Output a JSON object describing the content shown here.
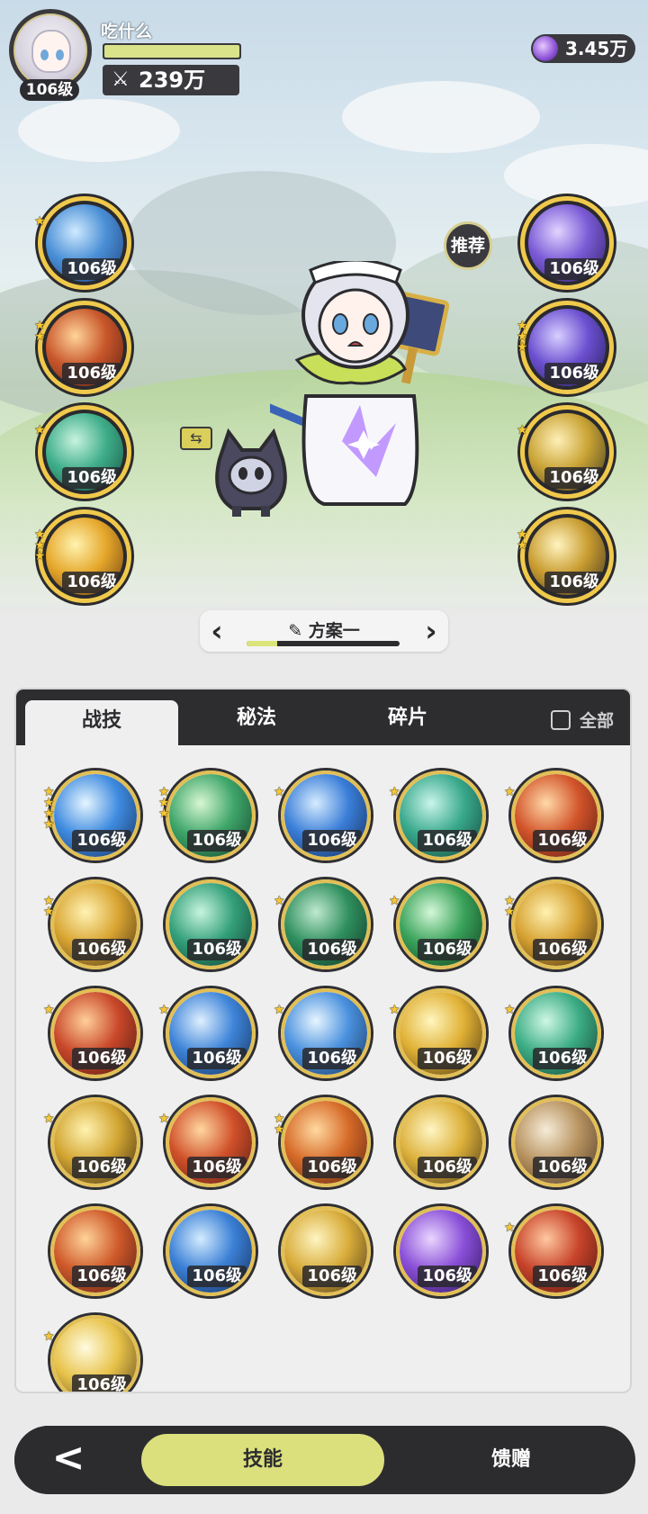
{
  "header": {
    "player_name": "吃什么",
    "level": "106级",
    "exp_progress": 1.0,
    "power": "239万",
    "currency": "3.45万"
  },
  "recommend_label": "推荐",
  "left_slots": [
    {
      "level": "106级",
      "stars": 1,
      "icon": "water-wave-icon",
      "colors": [
        "#cfeaff",
        "#4a8fd6",
        "#1e3f7a"
      ]
    },
    {
      "level": "106级",
      "stars": 2,
      "icon": "fire-meteor-icon",
      "colors": [
        "#ffd49a",
        "#c8562a",
        "#5a1d12"
      ]
    },
    {
      "level": "106级",
      "stars": 1,
      "icon": "wind-vortex-icon",
      "colors": [
        "#c8f3e0",
        "#3fae8a",
        "#14503f"
      ]
    },
    {
      "level": "106级",
      "stars": 3,
      "icon": "lightning-burst-icon",
      "colors": [
        "#fff3b0",
        "#e5a72a",
        "#6a3b10"
      ]
    }
  ],
  "right_slots": [
    {
      "level": "106级",
      "stars": 0,
      "icon": "arcane-stars-icon",
      "colors": [
        "#e1d4ff",
        "#7a5ad6",
        "#2a1d5c"
      ]
    },
    {
      "level": "106级",
      "stars": 3,
      "icon": "arcane-clock-icon",
      "colors": [
        "#d7cfff",
        "#6b4fd0",
        "#231c52"
      ]
    },
    {
      "level": "106级",
      "stars": 1,
      "icon": "golden-arrows-icon",
      "colors": [
        "#fff0b8",
        "#c9a334",
        "#3a3420"
      ]
    },
    {
      "level": "106级",
      "stars": 2,
      "icon": "golden-flash-icon",
      "colors": [
        "#fff4c0",
        "#c99c30",
        "#3a3120"
      ]
    }
  ],
  "plan": {
    "name": "方案一",
    "progress": 0.2
  },
  "tabs": [
    "战技",
    "秘法",
    "碎片"
  ],
  "active_tab": 0,
  "show_all_label": "全部",
  "skills": [
    {
      "level": "106级",
      "stars": 4,
      "icon": "ice-splash-icon",
      "colors": [
        "#e6f6ff",
        "#3f8be0",
        "#15305e"
      ]
    },
    {
      "level": "106级",
      "stars": 3,
      "icon": "green-comet-icon",
      "colors": [
        "#d8f7d3",
        "#3fa66a",
        "#12402a"
      ]
    },
    {
      "level": "106级",
      "stars": 1,
      "icon": "blue-comet-icon",
      "colors": [
        "#d6ecff",
        "#3a7ed8",
        "#132a55"
      ]
    },
    {
      "level": "106级",
      "stars": 1,
      "icon": "teal-spiral-icon",
      "colors": [
        "#c9f5ea",
        "#39a98c",
        "#124338"
      ]
    },
    {
      "level": "106级",
      "stars": 1,
      "icon": "flame-icon",
      "colors": [
        "#ffd9a8",
        "#d2542a",
        "#5a1a12"
      ]
    },
    {
      "level": "106级",
      "stars": 2,
      "icon": "golden-claw-icon",
      "colors": [
        "#fff3b4",
        "#d9a532",
        "#4a3212"
      ]
    },
    {
      "level": "106级",
      "stars": 0,
      "icon": "green-slash-icon",
      "colors": [
        "#c8f4df",
        "#33a07a",
        "#103b2c"
      ]
    },
    {
      "level": "106级",
      "stars": 1,
      "icon": "thorn-vine-icon",
      "colors": [
        "#bfe9cf",
        "#2f8f5e",
        "#0f3322"
      ]
    },
    {
      "level": "106级",
      "stars": 1,
      "icon": "green-plus-icon",
      "colors": [
        "#d4f8d8",
        "#39a25a",
        "#103a1d"
      ]
    },
    {
      "level": "106级",
      "stars": 2,
      "icon": "golden-sparks-icon",
      "colors": [
        "#fff1b0",
        "#d5a030",
        "#3f2c12"
      ]
    },
    {
      "level": "106级",
      "stars": 1,
      "icon": "fire-swirl-icon",
      "colors": [
        "#ffcf9a",
        "#c9482a",
        "#4e1710"
      ]
    },
    {
      "level": "106级",
      "stars": 1,
      "icon": "ice-crystal-icon",
      "colors": [
        "#dff0ff",
        "#3e84d8",
        "#14305a"
      ]
    },
    {
      "level": "106级",
      "stars": 1,
      "icon": "ice-spikes-icon",
      "colors": [
        "#e8f6ff",
        "#4a91de",
        "#173560"
      ]
    },
    {
      "level": "106级",
      "stars": 1,
      "icon": "golden-sun-icon",
      "colors": [
        "#fff6bf",
        "#e0b034",
        "#4b3512"
      ]
    },
    {
      "level": "106级",
      "stars": 1,
      "icon": "wind-orb-icon",
      "colors": [
        "#cff7e6",
        "#3cad85",
        "#123f30"
      ]
    },
    {
      "level": "106级",
      "stars": 1,
      "icon": "golden-triangle-icon",
      "colors": [
        "#fff3b0",
        "#d2a431",
        "#3c2c12"
      ]
    },
    {
      "level": "106级",
      "stars": 1,
      "icon": "fire-orb-icon",
      "colors": [
        "#ffd6a0",
        "#d0502a",
        "#561a12"
      ]
    },
    {
      "level": "106级",
      "stars": 2,
      "icon": "fire-burst-icon",
      "colors": [
        "#ffd9a0",
        "#d66a28",
        "#5a2210"
      ]
    },
    {
      "level": "106级",
      "stars": 0,
      "icon": "golden-explosion-icon",
      "colors": [
        "#fff6c4",
        "#dcb03a",
        "#4a3616"
      ]
    },
    {
      "level": "106级",
      "stars": 0,
      "icon": "card-trick-icon",
      "colors": [
        "#f6ecd8",
        "#b89360",
        "#4a3626"
      ]
    },
    {
      "level": "106级",
      "stars": 0,
      "icon": "fire-wave-icon",
      "colors": [
        "#ffd39a",
        "#cf5a2a",
        "#531a12"
      ]
    },
    {
      "level": "106级",
      "stars": 0,
      "icon": "blue-whirlpool-icon",
      "colors": [
        "#d4ecff",
        "#3b80d6",
        "#132b58"
      ]
    },
    {
      "level": "106级",
      "stars": 0,
      "icon": "golden-star-icon",
      "colors": [
        "#fff5c2",
        "#d8ac3a",
        "#4a3516"
      ]
    },
    {
      "level": "106级",
      "stars": 0,
      "icon": "purple-vortex-icon",
      "colors": [
        "#ead6ff",
        "#8a4fd8",
        "#2b1458"
      ]
    },
    {
      "level": "106级",
      "stars": 1,
      "icon": "red-shatter-icon",
      "colors": [
        "#ffc8a0",
        "#c8442a",
        "#4e1410"
      ]
    },
    {
      "level": "106级",
      "stars": 1,
      "icon": "golden-light-icon",
      "colors": [
        "#fffbe0",
        "#e8c34a",
        "#5a4218"
      ]
    }
  ],
  "bottom_bar": {
    "back_label": "<",
    "skills_label": "技能",
    "gift_label": "馈赠"
  }
}
